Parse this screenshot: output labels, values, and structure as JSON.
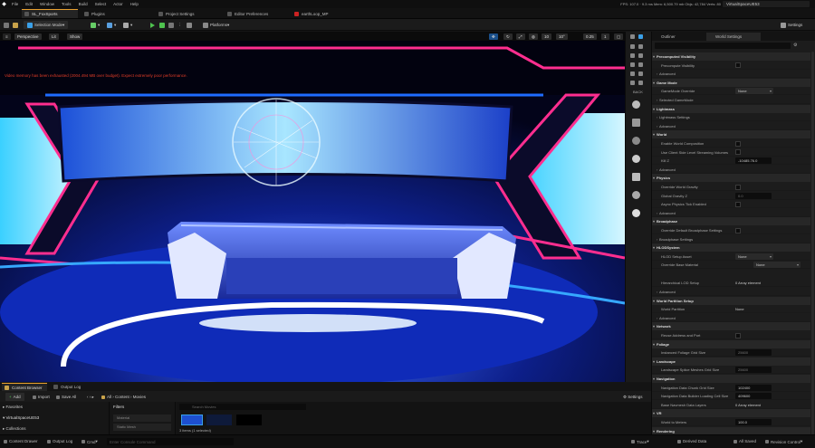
{
  "menubar": {
    "items": [
      "File",
      "Edit",
      "Window",
      "Tools",
      "Build",
      "Select",
      "Actor",
      "Help"
    ],
    "stats": "FPS: 107.0  ·  9.3 ms  Mem: 6,500.79 mb  Objs: 42,784  Verts: 80",
    "project": "VirtualSpaceUE53"
  },
  "tabs": [
    "SL_FoxSports",
    "Plugins",
    "Project Settings",
    "Editor Preferences",
    "earthLoop_MP"
  ],
  "toolbar": {
    "mode": "Selection Mode",
    "platforms": "Platforms",
    "settings": "Settings"
  },
  "viewport": {
    "perspective": "Perspective",
    "lit": "Lit",
    "show": "Show",
    "grid_snap": "10",
    "rot_snap": "10°",
    "scale_snap": "0.25",
    "cam_speed": "1",
    "warning": "Video memory has been exhausted (2004.494 MB over budget). Expect extremely poor performance."
  },
  "toolcol": {
    "back": "BACK"
  },
  "rightpanel": {
    "tabs": [
      "Outliner",
      "World Settings"
    ],
    "rows": [
      {
        "kind": "cat",
        "label": "Precomputed Visibility"
      },
      {
        "kind": "prop",
        "label": "Precompute Visibility",
        "val": "check"
      },
      {
        "kind": "sub",
        "label": "Advanced"
      },
      {
        "kind": "cat",
        "label": "Game Mode"
      },
      {
        "kind": "prop",
        "label": "GameMode Override",
        "val": "dd",
        "text": "None"
      },
      {
        "kind": "sub",
        "label": "Selected GameMode"
      },
      {
        "kind": "cat",
        "label": "Lightmass"
      },
      {
        "kind": "sub",
        "label": "Lightmass Settings"
      },
      {
        "kind": "sub",
        "label": "Advanced"
      },
      {
        "kind": "cat",
        "label": "World"
      },
      {
        "kind": "prop",
        "label": "Enable World Composition",
        "val": "check"
      },
      {
        "kind": "prop",
        "label": "Use Client Side Level Streaming Volumes",
        "val": "check"
      },
      {
        "kind": "prop",
        "label": "Kill Z",
        "val": "box",
        "text": "-10485.76.0"
      },
      {
        "kind": "sub",
        "label": "Advanced"
      },
      {
        "kind": "cat",
        "label": "Physics"
      },
      {
        "kind": "prop",
        "label": "Override World Gravity",
        "val": "check"
      },
      {
        "kind": "prop",
        "label": "Global Gravity Z",
        "val": "gray",
        "text": "0.0"
      },
      {
        "kind": "prop",
        "label": "Async Physics Tick Enabled",
        "val": "check"
      },
      {
        "kind": "sub",
        "label": "Advanced"
      },
      {
        "kind": "cat",
        "label": "Broadphase"
      },
      {
        "kind": "prop",
        "label": "Override Default Broadphase Settings",
        "val": "check"
      },
      {
        "kind": "sub",
        "label": "Broadphase Settings"
      },
      {
        "kind": "cat",
        "label": "HLODSystem"
      },
      {
        "kind": "prop",
        "label": "HLOD Setup Asset",
        "val": "dd",
        "text": "None"
      },
      {
        "kind": "prop",
        "label": "Override Base Material",
        "val": "dd2",
        "text": "None"
      },
      {
        "kind": "spacer"
      },
      {
        "kind": "prop",
        "label": "Hierarchical LOD Setup",
        "val": "plain",
        "text": "0 Array element"
      },
      {
        "kind": "sub",
        "label": "Advanced"
      },
      {
        "kind": "cat",
        "label": "World Partition Setup"
      },
      {
        "kind": "prop",
        "label": "World Partition",
        "val": "plain",
        "text": "None"
      },
      {
        "kind": "sub",
        "label": "Advanced"
      },
      {
        "kind": "cat",
        "label": "Network"
      },
      {
        "kind": "prop",
        "label": "Reuse Address and Port",
        "val": "check"
      },
      {
        "kind": "cat",
        "label": "Foliage"
      },
      {
        "kind": "prop",
        "label": "Instanced Foliage Grid Size",
        "val": "gray",
        "text": "25600"
      },
      {
        "kind": "cat",
        "label": "Landscape"
      },
      {
        "kind": "prop",
        "label": "Landscape Splice Meshes Grid Size",
        "val": "gray",
        "text": "25600"
      },
      {
        "kind": "cat",
        "label": "Navigation"
      },
      {
        "kind": "prop",
        "label": "Navigation Data Chunk Grid Size",
        "val": "box",
        "text": "102400"
      },
      {
        "kind": "prop",
        "label": "Navigation Data Builder Loading Cell Size",
        "val": "box",
        "text": "409600"
      },
      {
        "kind": "prop",
        "label": "Base Navmesh Data Layers",
        "val": "plain",
        "text": "0 Array element"
      },
      {
        "kind": "cat",
        "label": "VR"
      },
      {
        "kind": "prop",
        "label": "World to Meters",
        "val": "box",
        "text": "100.0"
      },
      {
        "kind": "cat",
        "label": "Rendering"
      }
    ]
  },
  "content": {
    "tabs": [
      "Content Browser",
      "Output Log"
    ],
    "add": "Add",
    "import": "Import",
    "save_all": "Save All",
    "path": [
      "All",
      "Content",
      "Movies"
    ],
    "settings": "Settings",
    "favorites": "Favorites",
    "project": "VirtualSpaceUE53",
    "collections": "Collections",
    "filters": "Filters",
    "filter_items": [
      "Material",
      "Static Mesh"
    ],
    "search_placeholder": "Search Movies",
    "items_count": "3 items (1 selected)"
  },
  "statusbar": {
    "content_drawer": "Content Drawer",
    "output_log": "Output Log",
    "cmd": "Cmd",
    "cmd_placeholder": "Enter Console Command",
    "trace": "Trace",
    "derived": "Derived Data",
    "all_saved": "All Saved",
    "revision": "Revision Control"
  },
  "colors": {
    "accent": "#e8a030",
    "play": "#4fc34f",
    "warning": "#e23d28",
    "neon_pink": "#ff2e8f",
    "neon_blue": "#1e6bff"
  }
}
